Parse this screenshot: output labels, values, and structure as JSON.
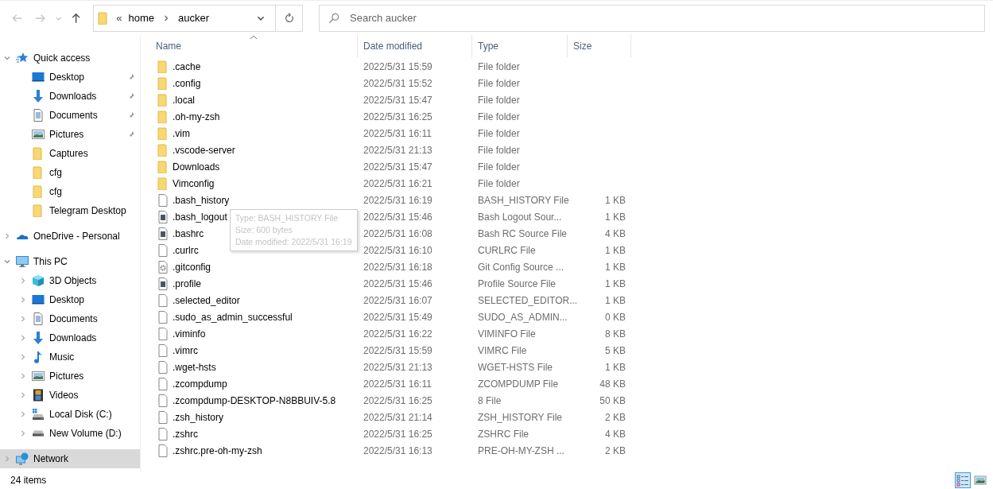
{
  "toolbar": {
    "back": {
      "disabled": true
    },
    "forward": {
      "disabled": true
    },
    "address": {
      "overflow": "«",
      "crumbs": [
        "home",
        "aucker"
      ]
    },
    "search": {
      "placeholder": "Search aucker"
    }
  },
  "sidebar": {
    "items": [
      {
        "label": "Quick access",
        "kind": "star",
        "expanded": true,
        "selected": false,
        "children": [
          {
            "label": "Desktop",
            "kind": "desktop",
            "pinned": true,
            "selected": false
          },
          {
            "label": "Downloads",
            "kind": "download",
            "pinned": true,
            "selected": false
          },
          {
            "label": "Documents",
            "kind": "documents",
            "pinned": true,
            "selected": false
          },
          {
            "label": "Pictures",
            "kind": "pictures",
            "pinned": true,
            "selected": false
          },
          {
            "label": "Captures",
            "kind": "folder",
            "pinned": false,
            "selected": false
          },
          {
            "label": "cfg",
            "kind": "folder",
            "pinned": false,
            "selected": false
          },
          {
            "label": "cfg",
            "kind": "folder",
            "pinned": false,
            "selected": false
          },
          {
            "label": "Telegram Desktop",
            "kind": "folder",
            "pinned": false,
            "selected": false
          }
        ]
      },
      {
        "label": "OneDrive - Personal",
        "kind": "cloud",
        "expanded": false,
        "selected": false
      },
      {
        "label": "This PC",
        "kind": "pc",
        "expanded": true,
        "selected": false,
        "children": [
          {
            "label": "3D Objects",
            "kind": "cube",
            "expanded": false,
            "selected": false
          },
          {
            "label": "Desktop",
            "kind": "desktop",
            "expanded": false,
            "selected": false
          },
          {
            "label": "Documents",
            "kind": "documents",
            "expanded": false,
            "selected": false
          },
          {
            "label": "Downloads",
            "kind": "download",
            "expanded": false,
            "selected": false
          },
          {
            "label": "Music",
            "kind": "music",
            "expanded": false,
            "selected": false
          },
          {
            "label": "Pictures",
            "kind": "pictures",
            "expanded": false,
            "selected": false
          },
          {
            "label": "Videos",
            "kind": "videos",
            "expanded": false,
            "selected": false
          },
          {
            "label": "Local Disk (C:)",
            "kind": "systemdisk",
            "expanded": false,
            "selected": false
          },
          {
            "label": "New Volume (D:)",
            "kind": "disk",
            "expanded": false,
            "selected": false
          }
        ]
      },
      {
        "label": "Network",
        "kind": "network",
        "expanded": false,
        "selected": true
      }
    ]
  },
  "table": {
    "columns": [
      {
        "label": "Name",
        "sorted": true
      },
      {
        "label": "Date modified",
        "sorted": false
      },
      {
        "label": "Type",
        "sorted": false
      },
      {
        "label": "Size",
        "sorted": false
      }
    ],
    "rows": [
      {
        "name": ".cache",
        "date": "2022/5/31 15:59",
        "type": "File folder",
        "kind": "folder"
      },
      {
        "name": ".config",
        "date": "2022/5/31 15:52",
        "type": "File folder",
        "kind": "folder"
      },
      {
        "name": ".local",
        "date": "2022/5/31 15:47",
        "type": "File folder",
        "kind": "folder"
      },
      {
        "name": ".oh-my-zsh",
        "date": "2022/5/31 16:25",
        "type": "File folder",
        "kind": "folder"
      },
      {
        "name": ".vim",
        "date": "2022/5/31 16:11",
        "type": "File folder",
        "kind": "folder"
      },
      {
        "name": ".vscode-server",
        "date": "2022/5/31 21:13",
        "type": "File folder",
        "kind": "folder"
      },
      {
        "name": "Downloads",
        "date": "2022/5/31 15:47",
        "type": "File folder",
        "kind": "folder"
      },
      {
        "name": "Vimconfig",
        "date": "2022/5/31 16:21",
        "type": "File folder",
        "kind": "folder"
      },
      {
        "name": ".bash_history",
        "date": "2022/5/31 16:19",
        "type": "BASH_HISTORY File",
        "size": "1 KB",
        "kind": "file"
      },
      {
        "name": ".bash_logout",
        "date": "2022/5/31 15:46",
        "type": "Bash Logout Sour...",
        "size": "1 KB",
        "kind": "script"
      },
      {
        "name": ".bashrc",
        "date": "2022/5/31 16:08",
        "type": "Bash RC Source File",
        "size": "4 KB",
        "kind": "script"
      },
      {
        "name": ".curlrc",
        "date": "2022/5/31 16:10",
        "type": "CURLRC File",
        "size": "1 KB",
        "kind": "file"
      },
      {
        "name": ".gitconfig",
        "date": "2022/5/31 16:18",
        "type": "Git Config Source ...",
        "size": "1 KB",
        "kind": "config"
      },
      {
        "name": ".profile",
        "date": "2022/5/31 15:46",
        "type": "Profile Source File",
        "size": "1 KB",
        "kind": "script"
      },
      {
        "name": ".selected_editor",
        "date": "2022/5/31 16:07",
        "type": "SELECTED_EDITOR...",
        "size": "1 KB",
        "kind": "file"
      },
      {
        "name": ".sudo_as_admin_successful",
        "date": "2022/5/31 15:49",
        "type": "SUDO_AS_ADMIN...",
        "size": "0 KB",
        "kind": "file"
      },
      {
        "name": ".viminfo",
        "date": "2022/5/31 16:22",
        "type": "VIMINFO File",
        "size": "8 KB",
        "kind": "file"
      },
      {
        "name": ".vimrc",
        "date": "2022/5/31 15:59",
        "type": "VIMRC File",
        "size": "5 KB",
        "kind": "file"
      },
      {
        "name": ".wget-hsts",
        "date": "2022/5/31 21:13",
        "type": "WGET-HSTS File",
        "size": "1 KB",
        "kind": "file"
      },
      {
        "name": ".zcompdump",
        "date": "2022/5/31 16:11",
        "type": "ZCOMPDUMP File",
        "size": "48 KB",
        "kind": "file"
      },
      {
        "name": ".zcompdump-DESKTOP-N8BBUIV-5.8",
        "date": "2022/5/31 16:25",
        "type": "8 File",
        "size": "50 KB",
        "kind": "file"
      },
      {
        "name": ".zsh_history",
        "date": "2022/5/31 21:14",
        "type": "ZSH_HISTORY File",
        "size": "2 KB",
        "kind": "file"
      },
      {
        "name": ".zshrc",
        "date": "2022/5/31 16:25",
        "type": "ZSHRC File",
        "size": "4 KB",
        "kind": "file"
      },
      {
        "name": ".zshrc.pre-oh-my-zsh",
        "date": "2022/5/31 16:13",
        "type": "PRE-OH-MY-ZSH ...",
        "size": "2 KB",
        "kind": "file"
      }
    ]
  },
  "tooltip": {
    "lines": [
      "Type: BASH_HISTORY File",
      "Size: 600 bytes",
      "Date modified: 2022/5/31 16:19"
    ]
  },
  "status_bar": {
    "count": "24 items",
    "views": [
      {
        "kind": "details",
        "selected": true
      },
      {
        "kind": "large-icons",
        "selected": false
      }
    ]
  }
}
